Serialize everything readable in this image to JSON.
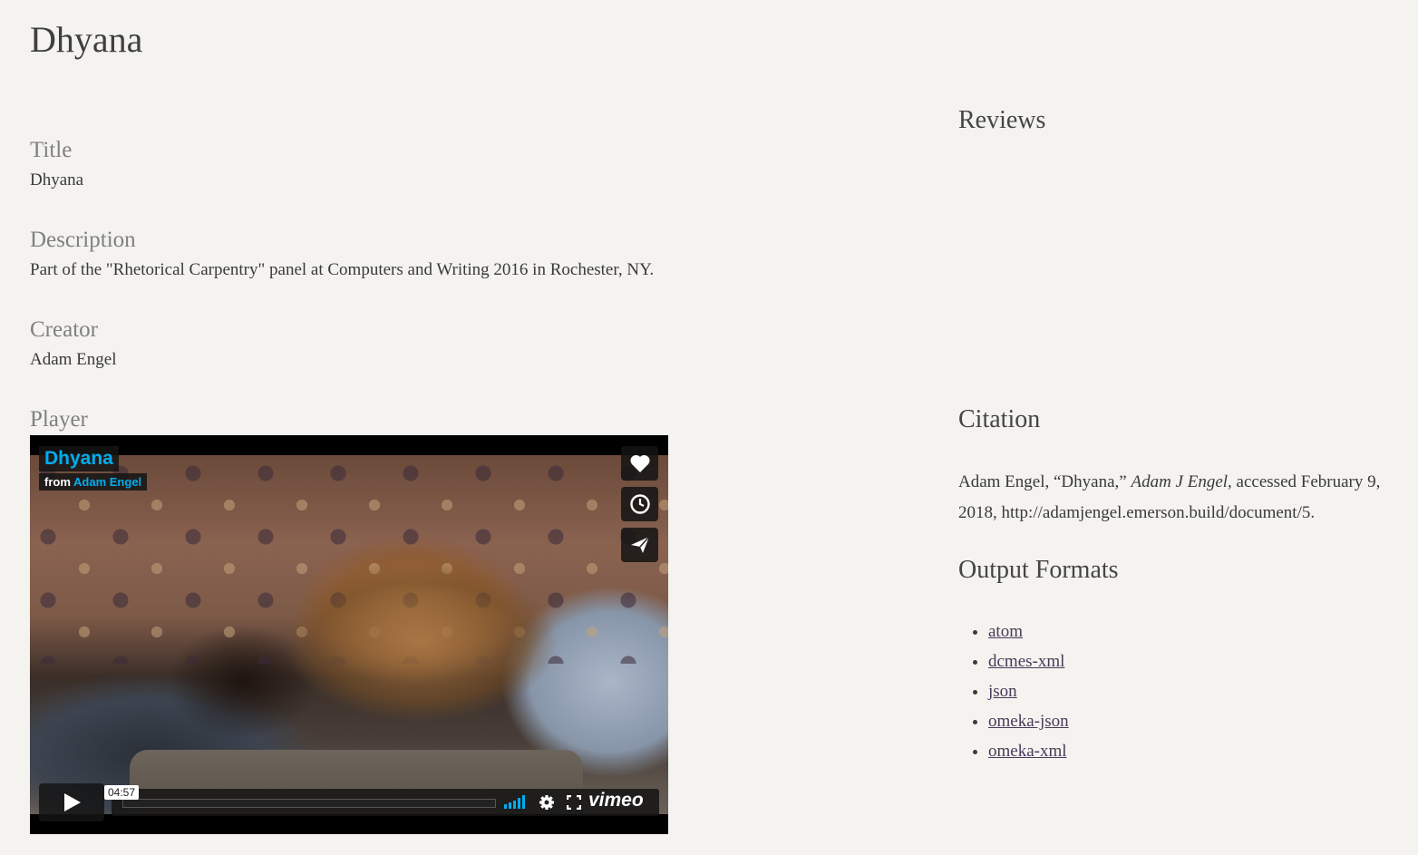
{
  "page": {
    "title": "Dhyana"
  },
  "fields": {
    "title": {
      "label": "Title",
      "value": "Dhyana"
    },
    "description": {
      "label": "Description",
      "value": "Part of the \"Rhetorical Carpentry\" panel at Computers and Writing 2016 in Rochester, NY."
    },
    "creator": {
      "label": "Creator",
      "value": "Adam Engel"
    },
    "player": {
      "label": "Player"
    }
  },
  "video": {
    "title": "Dhyana",
    "byline_prefix": "from",
    "author": "Adam Engel",
    "duration": "04:57",
    "brand": "vimeo",
    "icons": [
      "heart-icon",
      "clock-icon",
      "send-icon",
      "play-icon",
      "volume-icon",
      "gear-icon",
      "fullscreen-icon"
    ],
    "accent_color": "#00adef"
  },
  "sidebar": {
    "reviews_heading": "Reviews",
    "citation_heading": "Citation",
    "citation": {
      "before": "Adam Engel, “Dhyana,” ",
      "site": "Adam J Engel",
      "after": ", accessed February 9, 2018, http://adamjengel.emerson.build/document/5."
    },
    "output_formats_heading": "Output Formats",
    "output_formats": [
      "atom",
      "dcmes-xml",
      "json",
      "omeka-json",
      "omeka-xml"
    ]
  },
  "colors": {
    "background": "#f4f3ef",
    "label": "#808080",
    "link": "#4a3a5a"
  }
}
